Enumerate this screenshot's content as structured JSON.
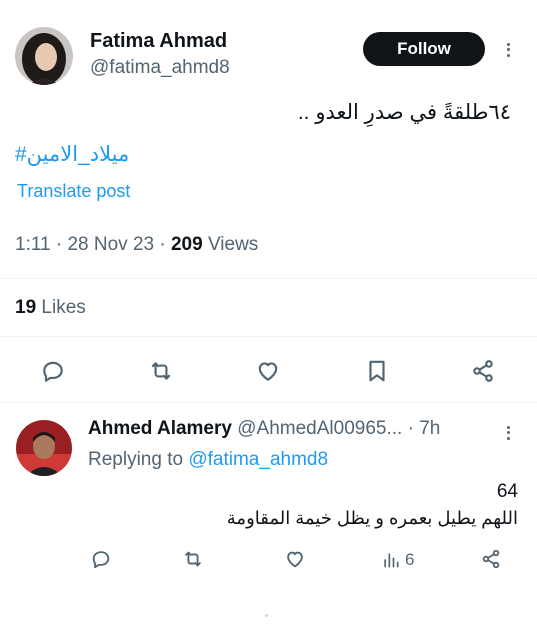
{
  "post": {
    "author_name": "Fatima Ahmad",
    "author_handle": "@fatima_ahmd8",
    "follow_label": "Follow",
    "text_line": "٦٤طلقةً في صدرِ العدو ..",
    "hashtag": "ميلاد_الامين#",
    "translate_label": "Translate post",
    "time": "1:11",
    "sep1": "·",
    "date": "28 Nov 23",
    "sep2": "·",
    "views_count": "209",
    "views_label": "Views",
    "likes_count": "19",
    "likes_label": "Likes",
    "actions": [
      "reply-icon",
      "repost-icon",
      "like-icon",
      "bookmark-icon",
      "share-icon"
    ]
  },
  "reply": {
    "author_name": "Ahmed Alamery",
    "author_handle": "@AhmedAl00965...",
    "age": "· 7h",
    "replying_prefix": "Replying to",
    "replying_handle": "@fatima_ahmd8",
    "line1": "64",
    "line2": "اللهم يطيل بعمره و يظل خيمة المقاومة",
    "views_count": "6"
  },
  "colors": {
    "accent": "#1d9bf0",
    "text": "#0f1419",
    "muted": "#536471",
    "button_bg": "#0f1419"
  }
}
